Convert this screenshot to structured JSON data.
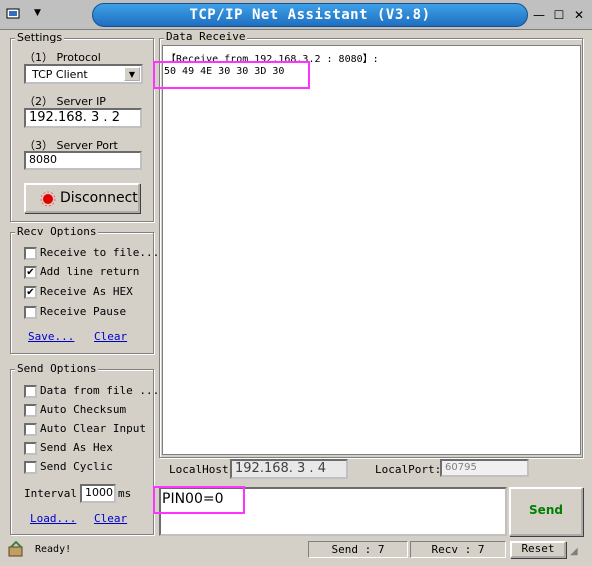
{
  "window": {
    "title": "TCP/IP Net Assistant (V3.8)"
  },
  "settings": {
    "group_label": "Settings",
    "protocol_label": "（1） Protocol",
    "protocol_value": "TCP Client",
    "server_ip_label": "（2） Server IP",
    "server_ip_value": "192.168. 3 . 2",
    "server_port_label": "（3） Server Port",
    "server_port_value": "8080",
    "connect_button": "Disconnect"
  },
  "recv_options": {
    "group_label": "Recv Options",
    "items": [
      {
        "label": "Receive to file...",
        "checked": false
      },
      {
        "label": "Add line return",
        "checked": true
      },
      {
        "label": "Receive As HEX",
        "checked": true
      },
      {
        "label": "Receive Pause",
        "checked": false
      }
    ],
    "save_link": "Save...",
    "clear_link": "Clear"
  },
  "send_options": {
    "group_label": "Send Options",
    "items": [
      {
        "label": "Data from file ...",
        "checked": false
      },
      {
        "label": "Auto Checksum",
        "checked": false
      },
      {
        "label": "Auto Clear Input",
        "checked": false
      },
      {
        "label": "Send As Hex",
        "checked": false
      },
      {
        "label": "Send Cyclic",
        "checked": false
      }
    ],
    "interval_label": "Interval",
    "interval_value": "1000",
    "interval_unit": "ms",
    "load_link": "Load...",
    "clear_link": "Clear"
  },
  "data_receive": {
    "group_label": "Data Receive",
    "header_line": "【Receive from 192.168.3.2 : 8080】:",
    "data_line": "50 49 4E 30 30 3D 30"
  },
  "network": {
    "local_host_label": "LocalHost:",
    "local_host_value": "192.168. 3 . 4",
    "local_port_label": "LocalPort:",
    "local_port_value": "60795"
  },
  "send_input": {
    "value": "PIN00=0"
  },
  "send_button": "Send",
  "status": {
    "ready_text": "Ready!",
    "send_count": "Send : 7",
    "recv_count": "Recv : 7",
    "reset_button": "Reset"
  },
  "colors": {
    "highlight": "#ff33ff",
    "send_green": "#008000",
    "title_blue": "#1f6fc0"
  }
}
